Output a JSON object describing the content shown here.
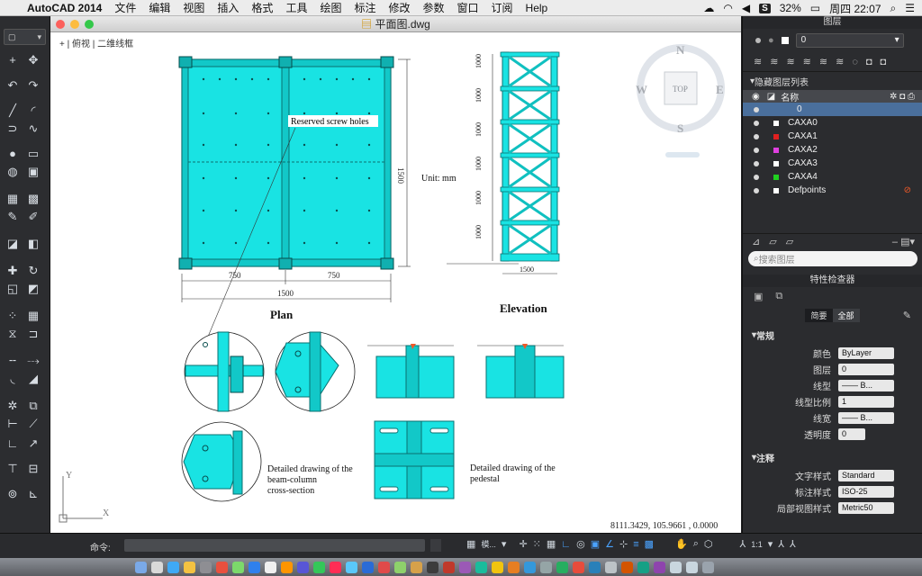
{
  "menubar": {
    "app_name": "AutoCAD 2014",
    "items": [
      "文件",
      "编辑",
      "视图",
      "插入",
      "格式",
      "工具",
      "绘图",
      "标注",
      "修改",
      "参数",
      "窗口",
      "订阅",
      "Help"
    ],
    "battery": "32%",
    "clock": "周四 22:07",
    "s_badge": "S"
  },
  "document": {
    "title": "平面图.dwg",
    "view_label": "+ | 俯视 | 二维线框"
  },
  "drawing": {
    "plan_label": "Plan",
    "elevation_label": "Elevation",
    "callout": "Reserved screw holes",
    "unit": "Unit: mm",
    "dim_750_left": "750",
    "dim_750_right": "750",
    "dim_1500_bottom": "1500",
    "dim_1500_side": "1500",
    "dim_1500_elev": "1500",
    "elev_dims": [
      "1000",
      "1000",
      "1000",
      "1000",
      "1000",
      "1000"
    ],
    "detail_beam_column": [
      "Detailed drawing of the",
      "beam-column",
      "cross-section"
    ],
    "detail_pedestal": [
      "Detailed drawing of the",
      "pedestal"
    ],
    "coordinates": "8111.3429, 105.9661 , 0.0000"
  },
  "viewcube": {
    "n": "N",
    "s": "S",
    "e": "E",
    "w": "W",
    "top": "TOP"
  },
  "layers": {
    "panel_title": "图层",
    "current_layer": "0",
    "hidden_list_label": "隐藏图层列表",
    "name_header": "名称",
    "rows": [
      {
        "name": "0",
        "color": "#ffffff"
      },
      {
        "name": "CAXA0",
        "color": "#ffffff"
      },
      {
        "name": "CAXA1",
        "color": "#e02020"
      },
      {
        "name": "CAXA2",
        "color": "#e040e0"
      },
      {
        "name": "CAXA3",
        "color": "#ffffff"
      },
      {
        "name": "CAXA4",
        "color": "#20d020"
      },
      {
        "name": "Defpoints",
        "color": "#ffffff"
      }
    ],
    "search_placeholder": "搜索图层"
  },
  "properties": {
    "panel_title": "特性检查器",
    "tab_brief": "简要",
    "tab_all": "全部",
    "section_general": "常规",
    "section_annotation": "注释",
    "rows": [
      {
        "label": "颜色",
        "value": "ByLayer"
      },
      {
        "label": "图层",
        "value": "0"
      },
      {
        "label": "线型",
        "value": "—— B..."
      },
      {
        "label": "线型比例",
        "value": "1"
      },
      {
        "label": "线宽",
        "value": "—— B..."
      },
      {
        "label": "透明度",
        "value": "0"
      }
    ],
    "annotation_rows": [
      {
        "label": "文字样式",
        "value": "Standard"
      },
      {
        "label": "标注样式",
        "value": "ISO-25"
      },
      {
        "label": "局部视图样式",
        "value": "Metric50"
      }
    ]
  },
  "commandbar": {
    "label": "命令:",
    "model_tab": "模...",
    "scale": "1:1"
  },
  "colors": {
    "steel": "#19e3e3",
    "steel_dark": "#0fb5b5",
    "accent": "#f05a28"
  }
}
